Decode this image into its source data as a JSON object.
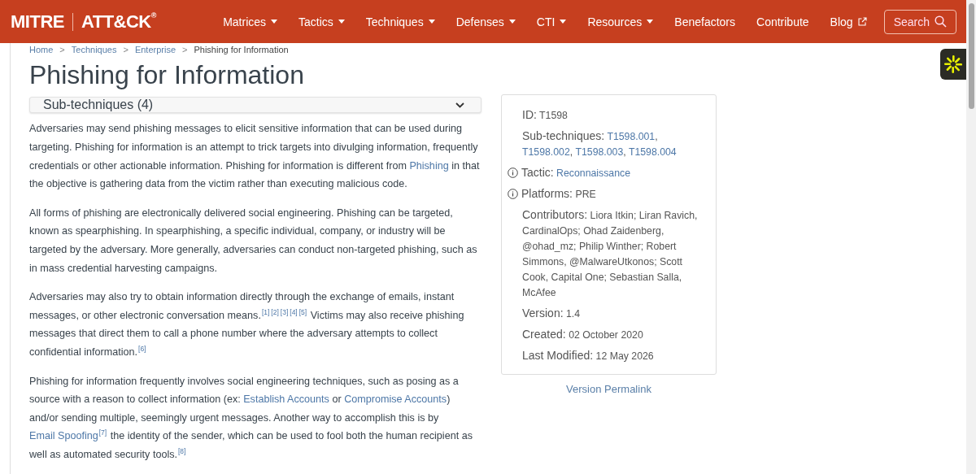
{
  "header": {
    "logo_left": "MITRE",
    "logo_right": "ATT&CK",
    "logo_mark": "®",
    "nav": [
      {
        "label": "Matrices",
        "kind": "dropdown"
      },
      {
        "label": "Tactics",
        "kind": "dropdown"
      },
      {
        "label": "Techniques",
        "kind": "dropdown"
      },
      {
        "label": "Defenses",
        "kind": "dropdown"
      },
      {
        "label": "CTI",
        "kind": "dropdown"
      },
      {
        "label": "Resources",
        "kind": "dropdown"
      },
      {
        "label": "Benefactors",
        "kind": "plain"
      },
      {
        "label": "Contribute",
        "kind": "plain"
      },
      {
        "label": "Blog",
        "kind": "external"
      }
    ],
    "search": "Search"
  },
  "breadcrumb": [
    {
      "label": "Home",
      "kind": "link"
    },
    {
      "label": "Techniques",
      "kind": "link"
    },
    {
      "label": "Enterprise",
      "kind": "link"
    },
    {
      "label": "Phishing for Information",
      "kind": "current"
    }
  ],
  "breadcrumb_separator": ">",
  "title": "Phishing for Information",
  "subtechniques": {
    "label": "Sub-techniques (4)",
    "expanded": false
  },
  "paragraphs": [
    [
      {
        "kind": "text",
        "text": "Adversaries may send phishing messages to elicit sensitive information that can be used during targeting. Phishing for information is an attempt to trick targets into divulging information, frequently credentials or other actionable information. Phishing for information is different from "
      },
      {
        "kind": "link",
        "text": "Phishing"
      },
      {
        "kind": "text",
        "text": " in that the objective is gathering data from the victim rather than executing malicious code."
      }
    ],
    [
      {
        "kind": "text",
        "text": "All forms of phishing are electronically delivered social engineering. Phishing can be targeted, known as spearphishing. In spearphishing, a specific individual, company, or industry will be targeted by the adversary. More generally, adversaries can conduct non-targeted phishing, such as in mass credential harvesting campaigns."
      }
    ],
    [
      {
        "kind": "text",
        "text": "Adversaries may also try to obtain information directly through the exchange of emails, instant messages, or other electronic conversation means."
      },
      {
        "kind": "ref",
        "text": "[1]"
      },
      {
        "kind": "ref",
        "text": "[2]"
      },
      {
        "kind": "ref",
        "text": "[3]"
      },
      {
        "kind": "ref",
        "text": "[4]"
      },
      {
        "kind": "ref",
        "text": "[5]"
      },
      {
        "kind": "text",
        "text": " Victims may also receive phishing messages that direct them to call a phone number where the adversary attempts to collect confidential information."
      },
      {
        "kind": "ref",
        "text": "[6]"
      }
    ],
    [
      {
        "kind": "text",
        "text": "Phishing for information frequently involves social engineering techniques, such as posing as a source with a reason to collect information (ex: "
      },
      {
        "kind": "link",
        "text": "Establish Accounts"
      },
      {
        "kind": "text",
        "text": " or "
      },
      {
        "kind": "link",
        "text": "Compromise Accounts"
      },
      {
        "kind": "text",
        "text": ") and/or sending multiple, seemingly urgent messages. Another way to accomplish this is by "
      },
      {
        "kind": "link",
        "text": "Email Spoofing"
      },
      {
        "kind": "ref",
        "text": "[7]"
      },
      {
        "kind": "text",
        "text": " the identity of the sender, which can be used to fool both the human recipient as well as automated security tools."
      },
      {
        "kind": "ref",
        "text": "[8]"
      }
    ]
  ],
  "card": [
    {
      "label": "ID:",
      "info": false,
      "parts": [
        {
          "kind": "text",
          "text": "T1598"
        }
      ]
    },
    {
      "label": "Sub-techniques:",
      "info": false,
      "parts": [
        {
          "kind": "link",
          "text": "T1598.001"
        },
        {
          "kind": "text",
          "text": ", "
        },
        {
          "kind": "link",
          "text": "T1598.002"
        },
        {
          "kind": "text",
          "text": ", "
        },
        {
          "kind": "link",
          "text": "T1598.003"
        },
        {
          "kind": "text",
          "text": ", "
        },
        {
          "kind": "link",
          "text": "T1598.004"
        }
      ]
    },
    {
      "label": "Tactic:",
      "info": true,
      "parts": [
        {
          "kind": "link",
          "text": "Reconnaissance"
        }
      ]
    },
    {
      "label": "Platforms:",
      "info": true,
      "parts": [
        {
          "kind": "text",
          "text": "PRE"
        }
      ]
    },
    {
      "label": "Contributors:",
      "info": false,
      "parts": [
        {
          "kind": "text",
          "text": "Liora Itkin; Liran Ravich, CardinalOps; Ohad Zaidenberg, @ohad_mz; Philip Winther; Robert Simmons, @MalwareUtkonos; Scott Cook, Capital One; Sebastian Salla, McAfee"
        }
      ]
    },
    {
      "label": "Version:",
      "info": false,
      "parts": [
        {
          "kind": "text",
          "text": "1.4"
        }
      ]
    },
    {
      "label": "Created:",
      "info": false,
      "parts": [
        {
          "kind": "text",
          "text": "02 October 2020"
        }
      ]
    },
    {
      "label": "Last Modified:",
      "info": false,
      "parts": [
        {
          "kind": "text",
          "text": "12 May 2026"
        }
      ]
    }
  ],
  "permalink": "Version Permalink"
}
